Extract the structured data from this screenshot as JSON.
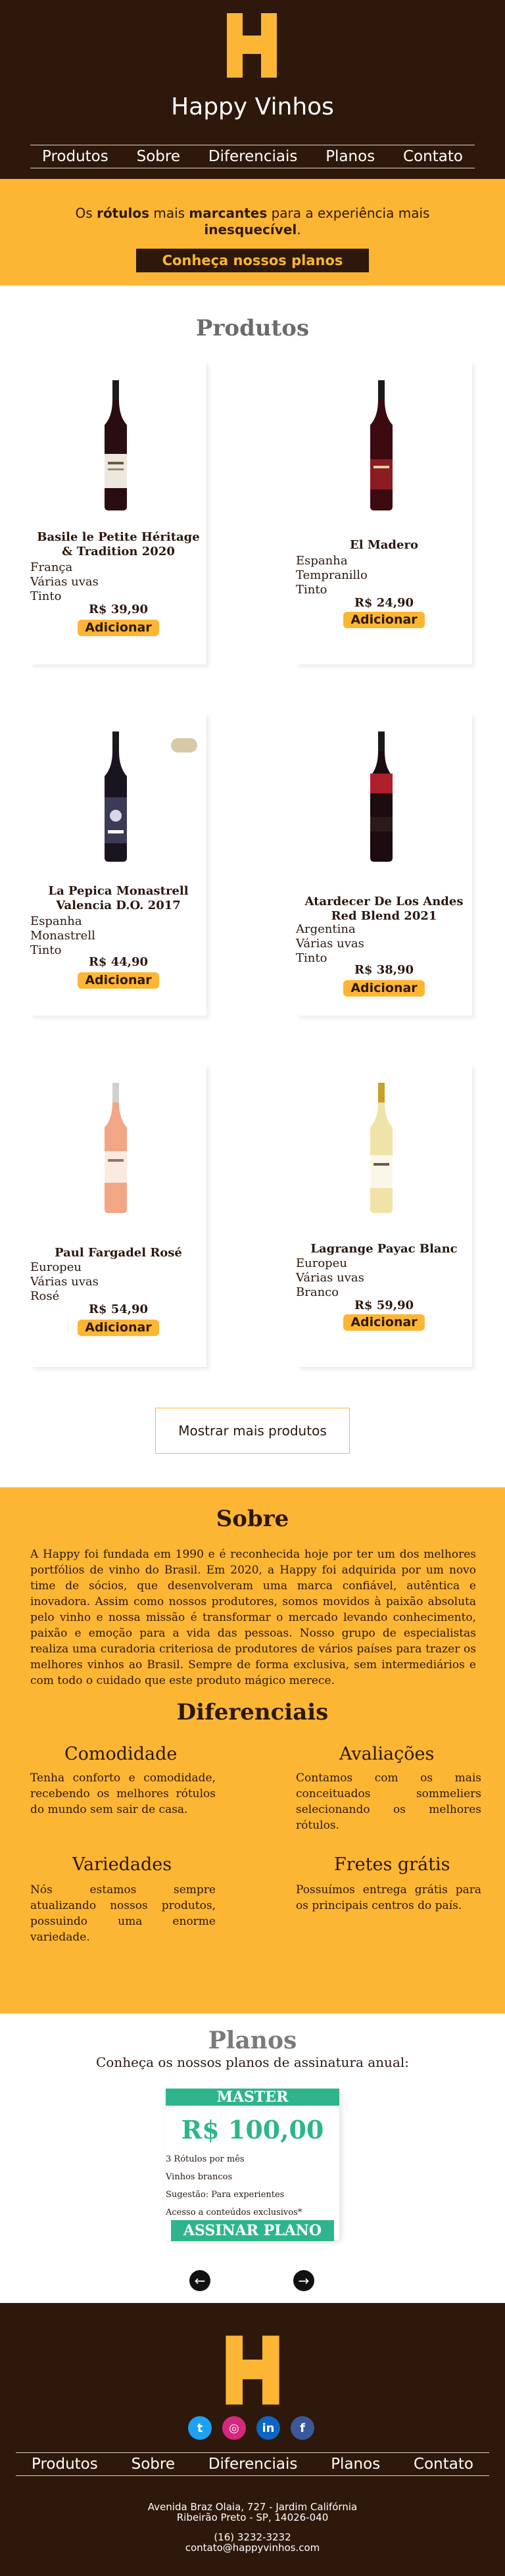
{
  "brand": {
    "name": "Happy Vinhos"
  },
  "nav": [
    "Produtos",
    "Sobre",
    "Diferenciais",
    "Planos",
    "Contato"
  ],
  "promo": {
    "text_pre": "Os ",
    "bold1": "rótulos",
    "text_mid": " mais ",
    "bold2": "marcantes",
    "text_post": " para a experiência mais",
    "bold3": "inesquecível",
    "text_end": ".",
    "cta": "Conheça nossos planos"
  },
  "products": {
    "title": "Produtos",
    "add_label": "Adicionar",
    "items": [
      {
        "name": "Basile le Petite Héritage & Tradition 2020",
        "attrs": [
          "França",
          "Várias uvas",
          "Tinto"
        ],
        "price": "R$ 39,90",
        "bottle": "red"
      },
      {
        "name": "El Madero",
        "attrs": [
          "Espanha",
          "Tempranillo",
          "Tinto"
        ],
        "price": "R$ 24,90",
        "bottle": "red"
      },
      {
        "name": "La Pepica Monastrell Valencia D.O. 2017",
        "attrs": [
          "Espanha",
          "Monastrell",
          "Tinto"
        ],
        "price": "R$ 44,90",
        "bottle": "red"
      },
      {
        "name": "Atardecer De Los Andes Red Blend 2021",
        "attrs": [
          "Argentina",
          "Várias uvas",
          "Tinto"
        ],
        "price": "R$ 38,90",
        "bottle": "red"
      },
      {
        "name": "Paul Fargadel Rosé",
        "attrs": [
          "Europeu",
          "Várias uvas",
          "Rosé"
        ],
        "price": "R$ 54,90",
        "bottle": "rose"
      },
      {
        "name": "Lagrange Payac Blanc",
        "attrs": [
          "Europeu",
          "Várias uvas",
          "Branco"
        ],
        "price": "R$ 59,90",
        "bottle": "white"
      }
    ],
    "more_label": "Mostrar mais produtos"
  },
  "sobre": {
    "title": "Sobre",
    "text": "A Happy foi fundada em 1990 e é reconhecida hoje por ter um dos melhores portfólios de vinho do Brasil. Em 2020, a Happy foi adquirida por um novo time de sócios, que desenvolveram uma marca confiável, autêntica e inovadora. Assim como nossos produtores, somos movidos à paixão absoluta pelo vinho e nossa missão é transformar o mercado levando conhecimento, paixão e emoção para a vida das pessoas. Nosso grupo de especialistas realiza uma curadoria criteriosa de produtores de vários países para trazer os melhores vinhos ao Brasil. Sempre de forma exclusiva, sem intermediários e com todo o cuidado que este produto mágico merece."
  },
  "diferenciais": {
    "title": "Diferenciais",
    "items": [
      {
        "title": "Comodidade",
        "text": "Tenha conforto e comodidade, recebendo os melhores rótulos do mundo sem sair de casa."
      },
      {
        "title": "Avaliações",
        "text": "Contamos com os mais conceituados sommeliers selecionando os melhores rótulos."
      },
      {
        "title": "Variedades",
        "text": "Nós estamos sempre atualizando nossos produtos, possuindo uma enorme variedade."
      },
      {
        "title": "Fretes grátis",
        "text": "Possuímos entrega grátis para os principais centros do país."
      }
    ]
  },
  "planos": {
    "title": "Planos",
    "subtitle": "Conheça os nossos planos de assinatura anual:",
    "plan": {
      "name": "MASTER",
      "price": "R$ 100,00",
      "features": [
        "3 Rótulos por mês",
        "Vinhos brancos",
        "Sugestão: Para experientes",
        "Acesso a conteúdos exclusivos*"
      ],
      "button": "ASSINAR PLANO"
    },
    "prev_icon": "arrow-left-icon",
    "next_icon": "arrow-right-icon"
  },
  "footer": {
    "social": [
      "twitter-icon",
      "instagram-icon",
      "linkedin-icon",
      "facebook-icon"
    ],
    "address1": "Avenida Braz Olaia, 727 - Jardim Califórnia",
    "address2": "Ribeirão Preto - SP, 14026-040",
    "phone": "(16) 3232-3232",
    "email": "contato@happyvinhos.com"
  },
  "colors": {
    "dark": "#2e180b",
    "accent": "#fdb633",
    "plan": "#2fb58d"
  }
}
